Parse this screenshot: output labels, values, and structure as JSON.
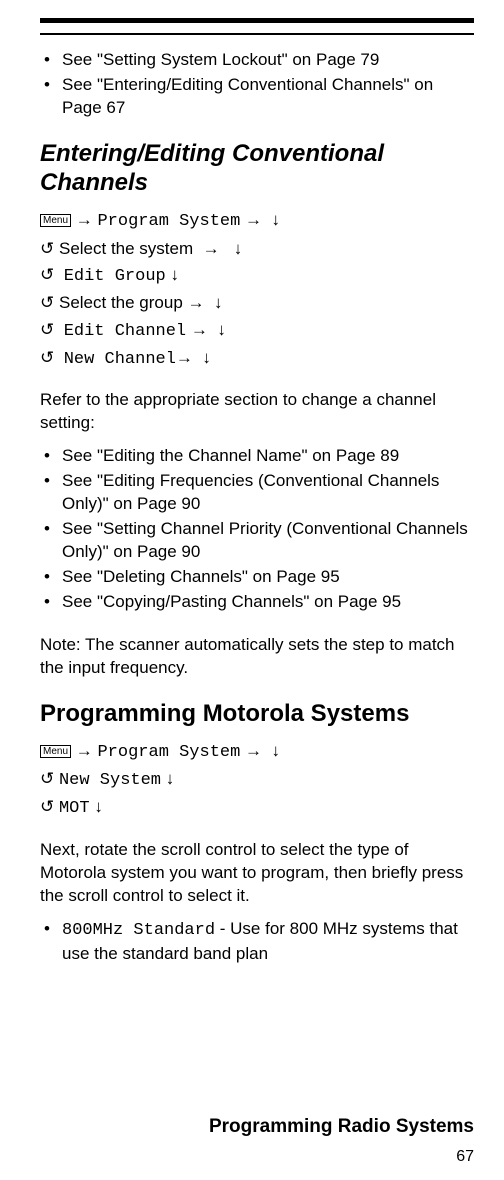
{
  "topBullets": [
    "See \"Setting System Lockout\" on Page 79",
    "See \"Entering/Editing Conventional Channels\" on Page 67"
  ],
  "section1": {
    "title": "Entering/Editing Conventional Channels",
    "menuLabel": "Menu",
    "nav": {
      "programSystem": "Program System",
      "selectSystem": "Select the system",
      "editGroup": "Edit Group",
      "selectGroup": "Select the group",
      "editChannel": "Edit Channel",
      "newChannel": "New Channel"
    },
    "referIntro": "Refer to the appropriate section to change a channel setting:",
    "referBullets": [
      "See \"Editing the Channel Name\" on Page 89",
      "See \"Editing Frequencies (Conventional Channels Only)\" on Page 90",
      "See \"Setting Channel Priority (Conventional Channels Only)\" on Page 90",
      "See \"Deleting Channels\" on Page 95",
      "See \"Copying/Pasting Channels\" on Page 95"
    ],
    "note": "Note: The scanner automatically sets the step to match the input frequency."
  },
  "section2": {
    "title": "Programming Motorola Systems",
    "menuLabel": "Menu",
    "nav": {
      "programSystem": "Program System",
      "newSystem": "New System",
      "mot": "MOT"
    },
    "body": "Next, rotate the scroll control to select the type of Motorola system you want to program, then briefly press the scroll control to select it.",
    "optionCode": "800MHz Standard",
    "optionDesc": " - Use for 800 MHz systems that use the standard band plan"
  },
  "footer": {
    "title": "Programming Radio Systems",
    "page": "67"
  },
  "glyphs": {
    "arrowRight": "→",
    "arrowDown": "↓",
    "rotate": "↺"
  }
}
